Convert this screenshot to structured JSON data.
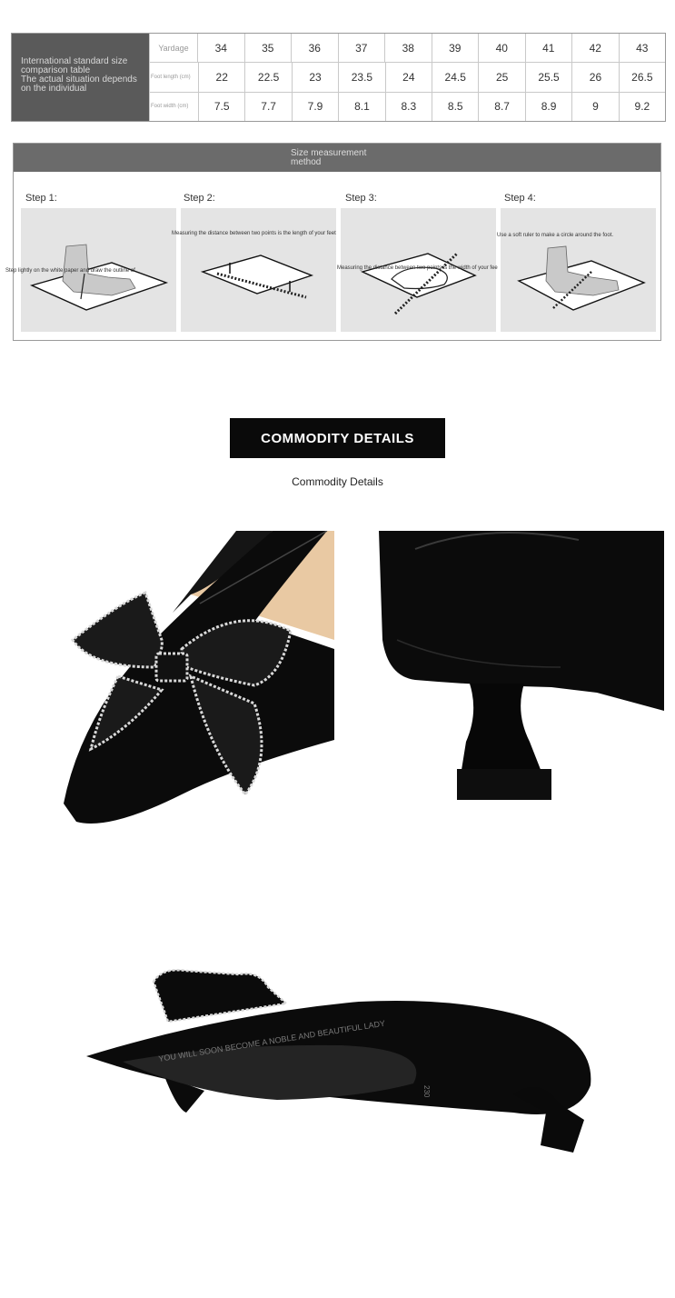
{
  "size_table": {
    "header_lines": [
      "International standard size",
      "comparison table",
      "The actual situation depends",
      "on the individual"
    ],
    "rows": [
      {
        "label": "Yardage",
        "values": [
          "34",
          "35",
          "36",
          "37",
          "38",
          "39",
          "40",
          "41",
          "42",
          "43"
        ]
      },
      {
        "label": "Foot length (cm)",
        "values": [
          "22",
          "22.5",
          "23",
          "23.5",
          "24",
          "24.5",
          "25",
          "25.5",
          "26",
          "26.5"
        ]
      },
      {
        "label": "Foot width (cm)",
        "values": [
          "7.5",
          "7.7",
          "7.9",
          "8.1",
          "8.3",
          "8.5",
          "8.7",
          "8.9",
          "9",
          "9.2"
        ]
      }
    ]
  },
  "measurement": {
    "title_line1": "Size measurement",
    "title_line2": "method",
    "steps": [
      {
        "label": "Step 1:",
        "caption": "Step lightly on the white paper and draw the outline of"
      },
      {
        "label": "Step 2:",
        "caption": "Measuring the distance between two points is the length of your feet"
      },
      {
        "label": "Step 3:",
        "caption": "Measuring the distance between two points is the width of your fee"
      },
      {
        "label": "Step 4:",
        "caption": "Use a soft ruler to make a circle around the foot."
      }
    ]
  },
  "commodity": {
    "banner": "COMMODITY DETAILS",
    "subtitle": "Commodity Details"
  },
  "sole_text": "YOU WILL SOON BECOME A NOBLE AND BEAUTIFUL LADY",
  "sole_size": "230",
  "colors": {
    "table_header": "#5a5a5a",
    "method_bar": "#6b6b6b",
    "banner": "#0a0a0a",
    "leather": "#0b0b0b",
    "lining": "#e9c9a3"
  }
}
